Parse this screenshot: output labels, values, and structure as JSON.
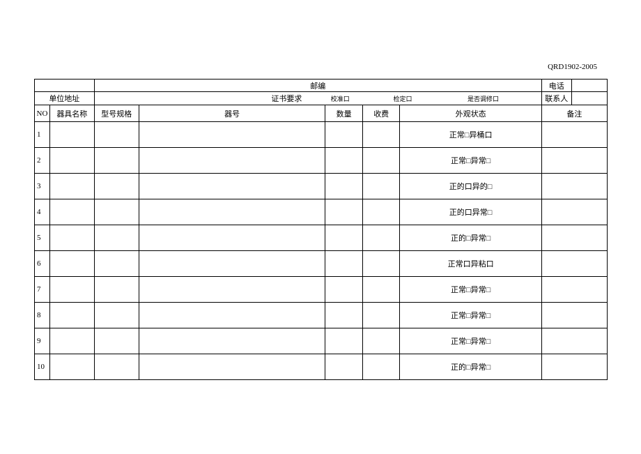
{
  "doc_code": "QRD1902-2005",
  "header": {
    "postcode_label": "邮编",
    "phone_label": "电话",
    "address_label": "单位地址",
    "cert_req_label": "证书要求",
    "contact_label": "联系人",
    "req_opts": {
      "calibration": "校准口",
      "verification": "检定口",
      "adjustment": "是否调修口"
    }
  },
  "columns": {
    "no": "NO",
    "name": "器具名称",
    "model": "型号规格",
    "serial": "器号",
    "qty": "数量",
    "fee": "收费",
    "appearance": "外观状态",
    "remark": "备注"
  },
  "rows": [
    {
      "no": "1",
      "appearance": "正常□异桶口"
    },
    {
      "no": "2",
      "appearance": "正常□异常□"
    },
    {
      "no": "3",
      "appearance": "正的口异的□"
    },
    {
      "no": "4",
      "appearance": "正的口异常□"
    },
    {
      "no": "5",
      "appearance": "正的□异常□"
    },
    {
      "no": "6",
      "appearance": "正常口异粘口"
    },
    {
      "no": "7",
      "appearance": "正常□异常□"
    },
    {
      "no": "8",
      "appearance": "正常□异常□"
    },
    {
      "no": "9",
      "appearance": "正常□异常□"
    },
    {
      "no": "10",
      "appearance": "正的□异常□"
    }
  ]
}
